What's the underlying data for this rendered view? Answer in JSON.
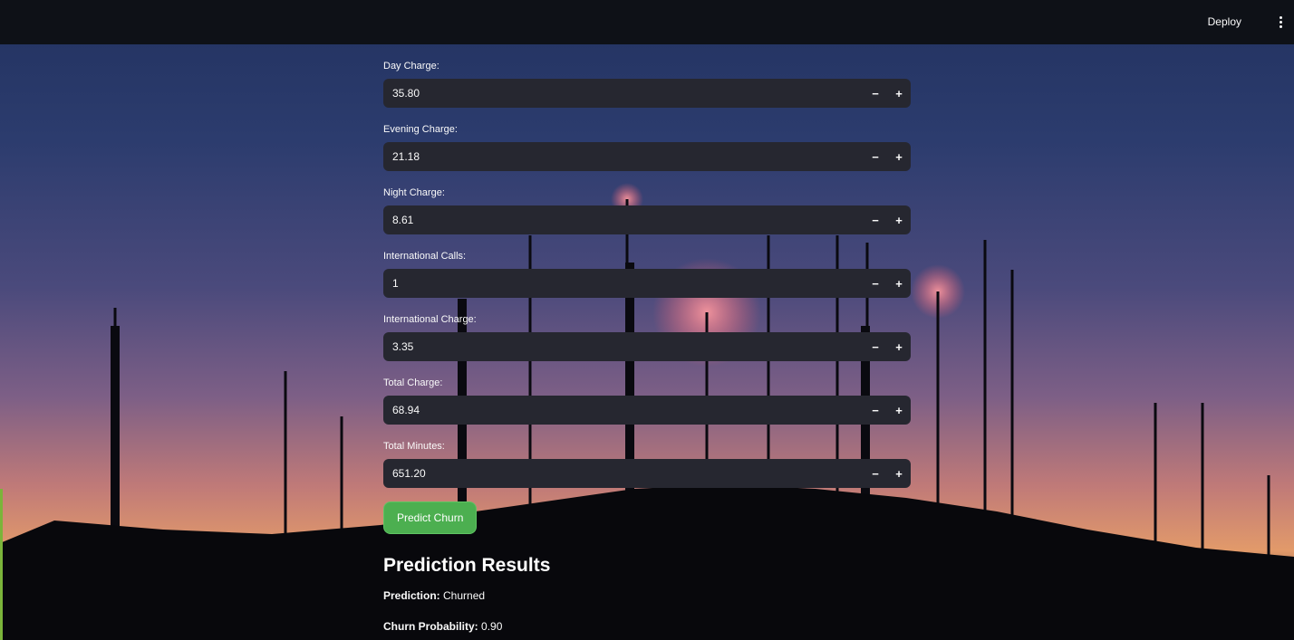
{
  "header": {
    "deploy_label": "Deploy",
    "menu_icon": "vertical-ellipsis-icon"
  },
  "fields": [
    {
      "label": "Day Charge:",
      "value": "35.80"
    },
    {
      "label": "Evening Charge:",
      "value": "21.18"
    },
    {
      "label": "Night Charge:",
      "value": "8.61"
    },
    {
      "label": "International Calls:",
      "value": "1"
    },
    {
      "label": "International Charge:",
      "value": "3.35"
    },
    {
      "label": "Total Charge:",
      "value": "68.94"
    },
    {
      "label": "Total Minutes:",
      "value": "651.20"
    }
  ],
  "stepper": {
    "minus": "−",
    "plus": "+"
  },
  "predict_button": "Predict Churn",
  "results": {
    "title": "Prediction Results",
    "prediction_label": "Prediction:",
    "prediction_value": "Churned",
    "probability_label": "Churn Probability:",
    "probability_value": "0.90"
  },
  "colors": {
    "topbar": "#0e1117",
    "input_bg": "#262730",
    "button": "#4caf50"
  }
}
